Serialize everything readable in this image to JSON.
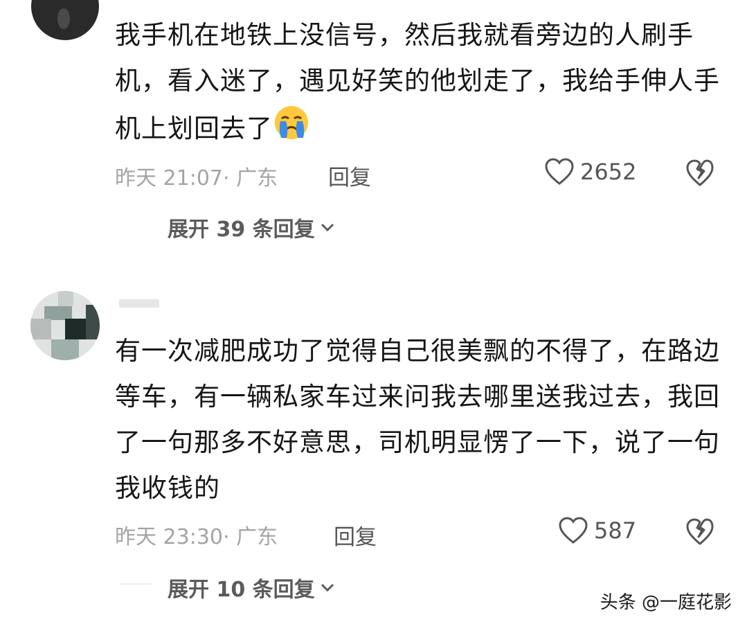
{
  "comments": [
    {
      "text": "我手机在地铁上没信号，然后我就看旁边的人刷手机，看入迷了，遇见好笑的他划走了，我给手伸人手机上划回去了",
      "emoji": "crying-face-emoji",
      "time_location": "昨天 21:07· 广东",
      "reply_label": "回复",
      "likes": "2652",
      "expand_label": "展开 39 条回复"
    },
    {
      "text": "有一次减肥成功了觉得自己很美飘的不得了，在路边等车，有一辆私家车过来问我去哪里送我过去，我回了一句那多不好意思，司机明显愣了一下，说了一句我收钱的",
      "time_location": "昨天 23:30· 广东",
      "reply_label": "回复",
      "likes": "587",
      "expand_label": "展开 10 条回复"
    }
  ],
  "watermark": "头条 @一庭花影",
  "colors": {
    "text": "#161616",
    "meta": "#a4a4a4",
    "action": "#555555",
    "emoji_face": "#ffc83d",
    "emoji_tear": "#3b8ce8"
  }
}
